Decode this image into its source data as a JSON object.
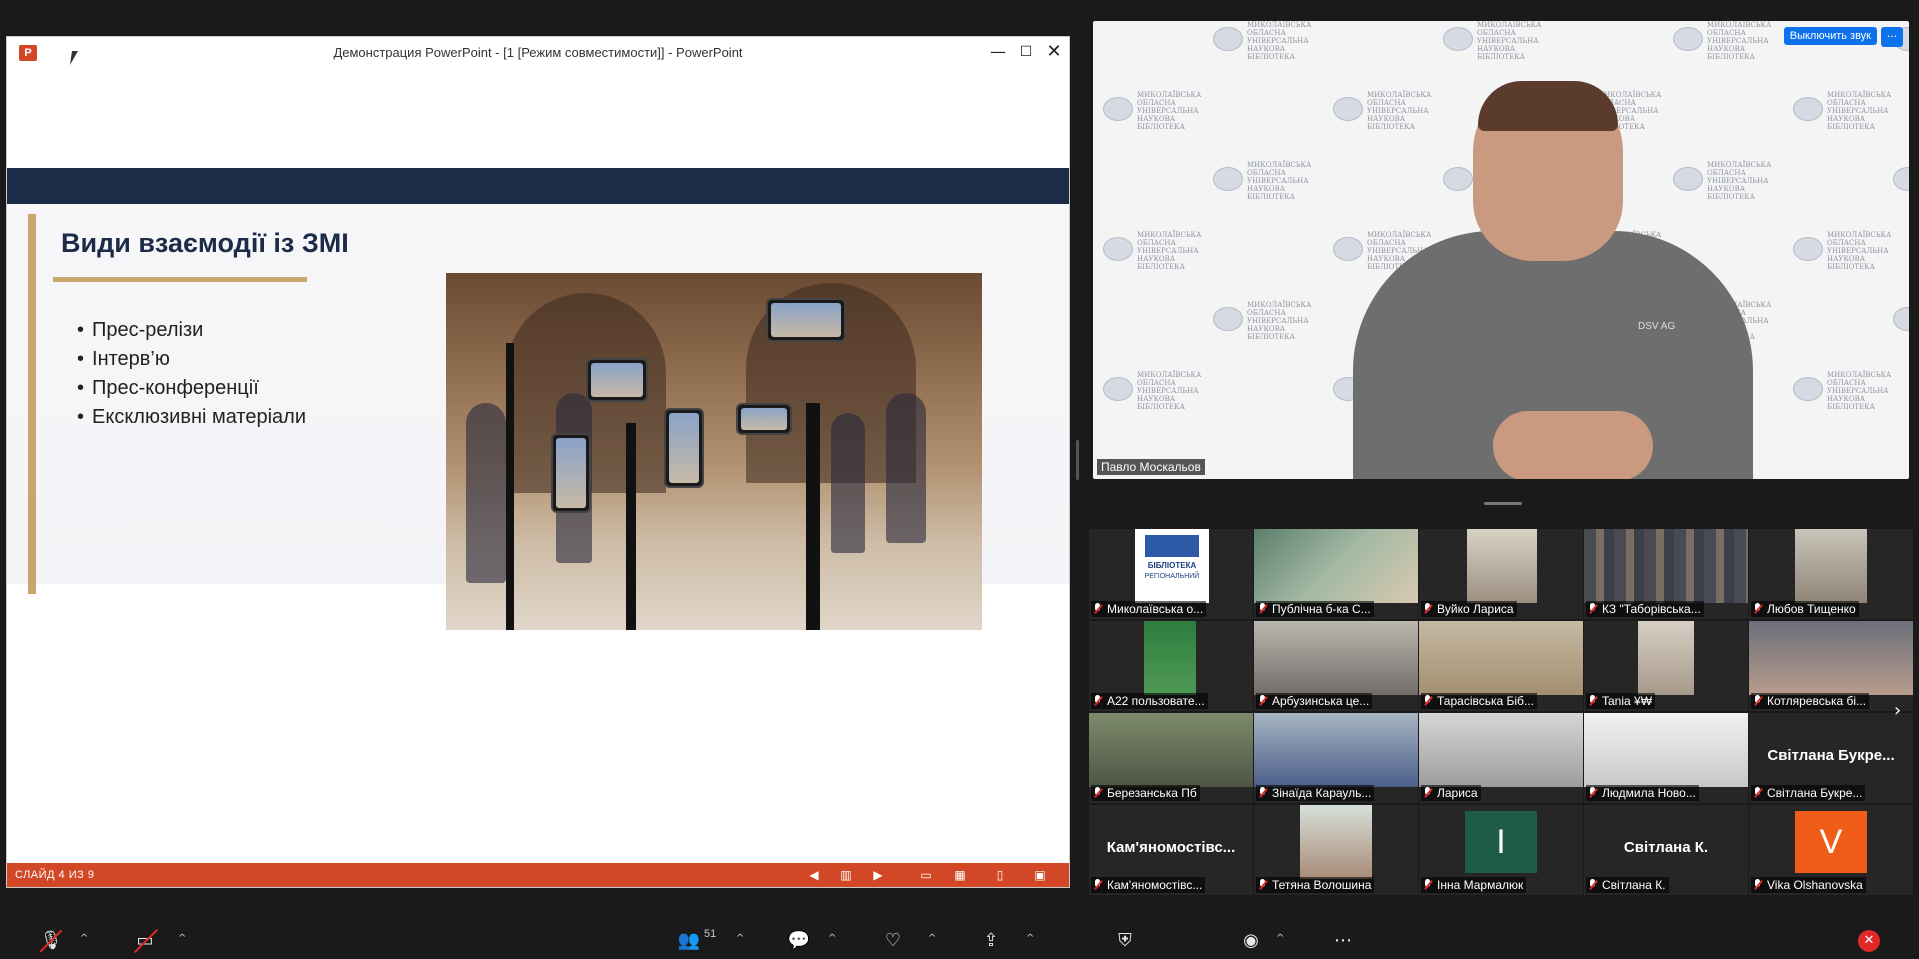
{
  "powerpoint": {
    "window_title": "Демонстрация PowerPoint - [1 [Режим совместимости]] - PowerPoint",
    "logo_letter": "P",
    "minimize_glyph": "—",
    "maximize_glyph": "☐",
    "close_glyph": "✕",
    "slide": {
      "title": "Види взаємодії із ЗМІ",
      "bullets": [
        "Прес-релізи",
        "Інтерв’ю",
        "Прес-конференції",
        "Ексклюзивні матеріали"
      ]
    },
    "status": {
      "slide_counter": "СЛАЙД 4 ИЗ 9",
      "accent_color": "#d24726"
    }
  },
  "speaker": {
    "name": "Павло Москальов",
    "mute_button": "Выключить звук",
    "more_button": "···",
    "backdrop_text": "МИКОЛАЇВСЬКА ОБЛАСНА УНІВЕРСАЛЬНА НАУКОВА БІБЛІОТЕКА",
    "shirt_text": "DSV AG"
  },
  "gallery": {
    "row1": [
      "Миколаївська о...",
      "Публічна б-ка С...",
      "Вуйко Лариса",
      "КЗ \"Таборівська...",
      "Любов Тищенко"
    ],
    "row2": [
      "A22 пользовате...",
      "Арбузинська це...",
      "Тарасівська Біб...",
      "Tania ¥₩",
      "Котляревська бі..."
    ],
    "row3": [
      "Березанська Пб",
      "Зінаїда Карауль...",
      "Лариса",
      "Людмила Ново...",
      "Світлана Букре..."
    ],
    "row3_big_name": "Світлана Букре...",
    "row4": [
      "Кам'яномостівс...",
      "Тетяна Волошина",
      "Інна Мармалюк",
      "Світлана К.",
      "Vika Olshanovska"
    ],
    "row4_big_names": {
      "kamianomostivs": "Кам'яномостівс...",
      "svitlana_k": "Світлана К."
    },
    "avatar_letters": {
      "inna": "I",
      "vika": "V"
    },
    "library_logo_text": "РЕГІОНАЛЬНИЙ",
    "library_logo_title": "БІБЛІОТЕКА",
    "next_arrow": "›"
  },
  "toolbar": {
    "participants_count": "51",
    "end_glyph": "✕",
    "end_color": "#e02828"
  }
}
